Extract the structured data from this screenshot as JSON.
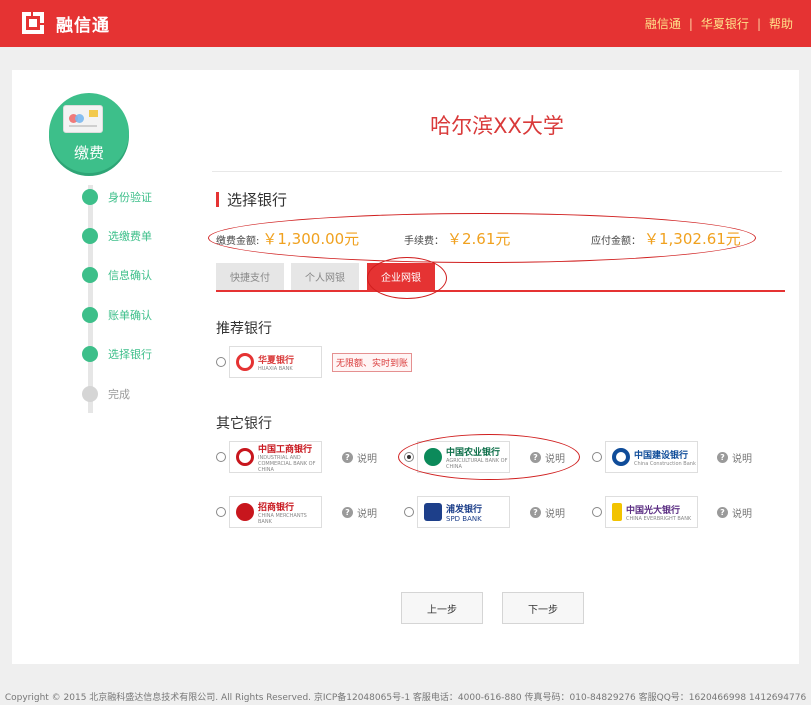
{
  "header": {
    "app_name": "融信通",
    "nav": [
      "融信通",
      "华夏银行",
      "帮助"
    ],
    "brand_color": "#e53333"
  },
  "sidebar": {
    "badge_label": "缴费",
    "steps": [
      {
        "label": "身份验证",
        "done": true
      },
      {
        "label": "选缴费单",
        "done": true
      },
      {
        "label": "信息确认",
        "done": true
      },
      {
        "label": "账单确认",
        "done": true
      },
      {
        "label": "选择银行",
        "done": true
      },
      {
        "label": "完成",
        "done": false
      }
    ]
  },
  "main": {
    "title": "哈尔滨XX大学",
    "section_title": "选择银行",
    "fees": [
      {
        "label": "缴费金额:",
        "amount": "￥1,300.00元"
      },
      {
        "label": "手续费：",
        "amount": "￥2.61元"
      },
      {
        "label": "应付金额：",
        "amount": "￥1,302.61元"
      }
    ],
    "tabs": [
      "快捷支付",
      "个人网银",
      "企业网银"
    ],
    "active_tab": "企业网银",
    "recommended_title": "推荐银行",
    "recommended_bank": {
      "name": "华夏银行",
      "sub": "HUAXIA BANK",
      "tag": "无限额、实时到账"
    },
    "other_title": "其它银行",
    "explain_label": "说明",
    "other_banks": [
      {
        "name": "中国工商银行",
        "sub": "INDUSTRIAL AND COMMERCIAL BANK OF CHINA",
        "selected": false
      },
      {
        "name": "中国农业银行",
        "sub": "AGRICULTURAL BANK OF CHINA",
        "selected": true
      },
      {
        "name": "中国建设银行",
        "sub": "China Construction Bank",
        "selected": false
      },
      {
        "name": "招商银行",
        "sub": "CHINA MERCHANTS BANK",
        "selected": false
      },
      {
        "name": "浦发银行",
        "sub": "SPD BANK",
        "selected": false
      },
      {
        "name": "中国光大银行",
        "sub": "CHINA EVERBRIGHT BANK",
        "selected": false
      }
    ],
    "prev_label": "上一步",
    "next_label": "下一步"
  },
  "footer": {
    "text": "Copyright © 2015 北京融科盛达信息技术有限公司. All Rights Reserved. 京ICP备12048065号-1 客服电话：4000-616-880 传真号码：010-84829276 客服QQ号：1620466998 1412694776"
  }
}
